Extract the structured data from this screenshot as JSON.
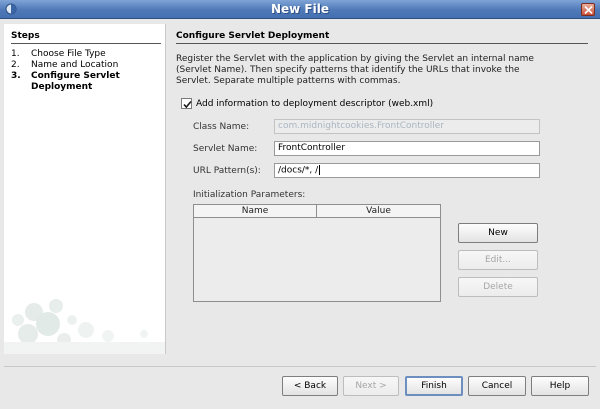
{
  "window": {
    "title": "New File"
  },
  "steps": {
    "header": "Steps",
    "items": [
      {
        "num": "1.",
        "label": "Choose File Type"
      },
      {
        "num": "2.",
        "label": "Name and Location"
      },
      {
        "num": "3.",
        "label": "Configure Servlet Deployment",
        "current": true
      }
    ]
  },
  "content": {
    "header": "Configure Servlet Deployment",
    "description": "Register the Servlet with the application by giving the Servlet an internal name (Servlet Name). Then specify patterns that identify the URLs that invoke the Servlet. Separate multiple patterns with commas.",
    "checkbox_label": "Add information to deployment descriptor (web.xml)",
    "checkbox_checked": true,
    "class_name_label": "Class Name:",
    "class_name_value": "com.midnightcookies.FrontController",
    "servlet_name_label": "Servlet Name:",
    "servlet_name_value": "FrontController",
    "url_pattern_label": "URL Pattern(s):",
    "url_pattern_value": "/docs/*, /",
    "init_params_label": "Initialization Parameters:",
    "table_columns": [
      "Name",
      "Value"
    ],
    "new_button": "New",
    "edit_button": "Edit...",
    "delete_button": "Delete"
  },
  "footer": {
    "back": "< Back",
    "next": "Next >",
    "finish": "Finish",
    "cancel": "Cancel",
    "help": "Help"
  }
}
